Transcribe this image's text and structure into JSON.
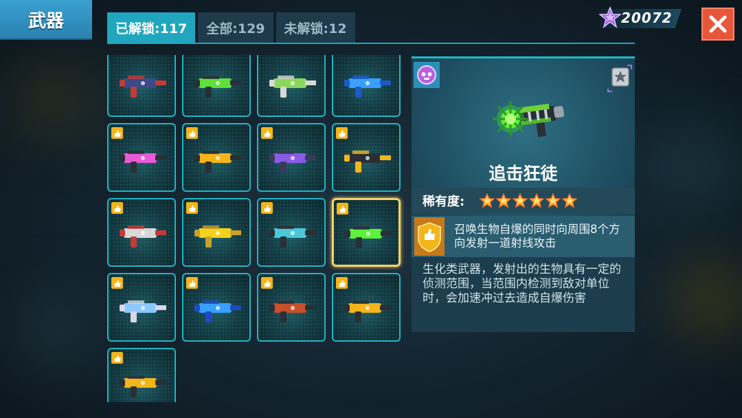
{
  "header": {
    "title": "武器"
  },
  "tabs": [
    {
      "label": "已解锁:117",
      "active": true
    },
    {
      "label": "全部:129",
      "active": false
    },
    {
      "label": "未解锁:12",
      "active": false
    }
  ],
  "currency": {
    "value": "20072",
    "icon": "purple-star-icon"
  },
  "close_icon": "close-icon",
  "colors": {
    "accent": "#20b8c8",
    "selected": "#f3d36b",
    "badge": "#f2b51a",
    "close": "#e8563a",
    "tab_active": "#20a6bf"
  },
  "weapons": [
    {
      "name": "weapon-dark-blaster",
      "badge": false
    },
    {
      "name": "weapon-green-cannon",
      "badge": false
    },
    {
      "name": "weapon-green-rifle",
      "badge": false
    },
    {
      "name": "weapon-blue-laser",
      "badge": false
    },
    {
      "name": "weapon-pink-pistol",
      "badge": true
    },
    {
      "name": "weapon-gold-staff",
      "badge": true
    },
    {
      "name": "weapon-purple-blaster",
      "badge": true
    },
    {
      "name": "weapon-gatling-gun",
      "badge": true
    },
    {
      "name": "weapon-drill-cannon",
      "badge": true
    },
    {
      "name": "weapon-gold-disc-gun",
      "badge": true
    },
    {
      "name": "weapon-crossbow",
      "badge": true
    },
    {
      "name": "weapon-bio-launcher",
      "badge": true,
      "selected": true
    },
    {
      "name": "weapon-duck-blaster",
      "badge": true
    },
    {
      "name": "weapon-blue-orb-gun",
      "badge": true
    },
    {
      "name": "weapon-rocket-launcher",
      "badge": true
    },
    {
      "name": "weapon-gold-smg",
      "badge": true
    },
    {
      "name": "weapon-spiked-mace",
      "badge": true
    }
  ],
  "detail": {
    "name": "追击狂徒",
    "type_icon": "bio-type-icon",
    "rank_icon": "star-rank-icon",
    "rarity_label": "稀有度:",
    "rarity": 6,
    "skill_icon": "shield-badge-icon",
    "skill": "召唤生物自爆的同时向周围8个方向发射一道射线攻击",
    "description": "生化类武器，发射出的生物具有一定的侦测范围，当范围内检测到敌对单位时，会加速冲过去造成自爆伤害"
  }
}
